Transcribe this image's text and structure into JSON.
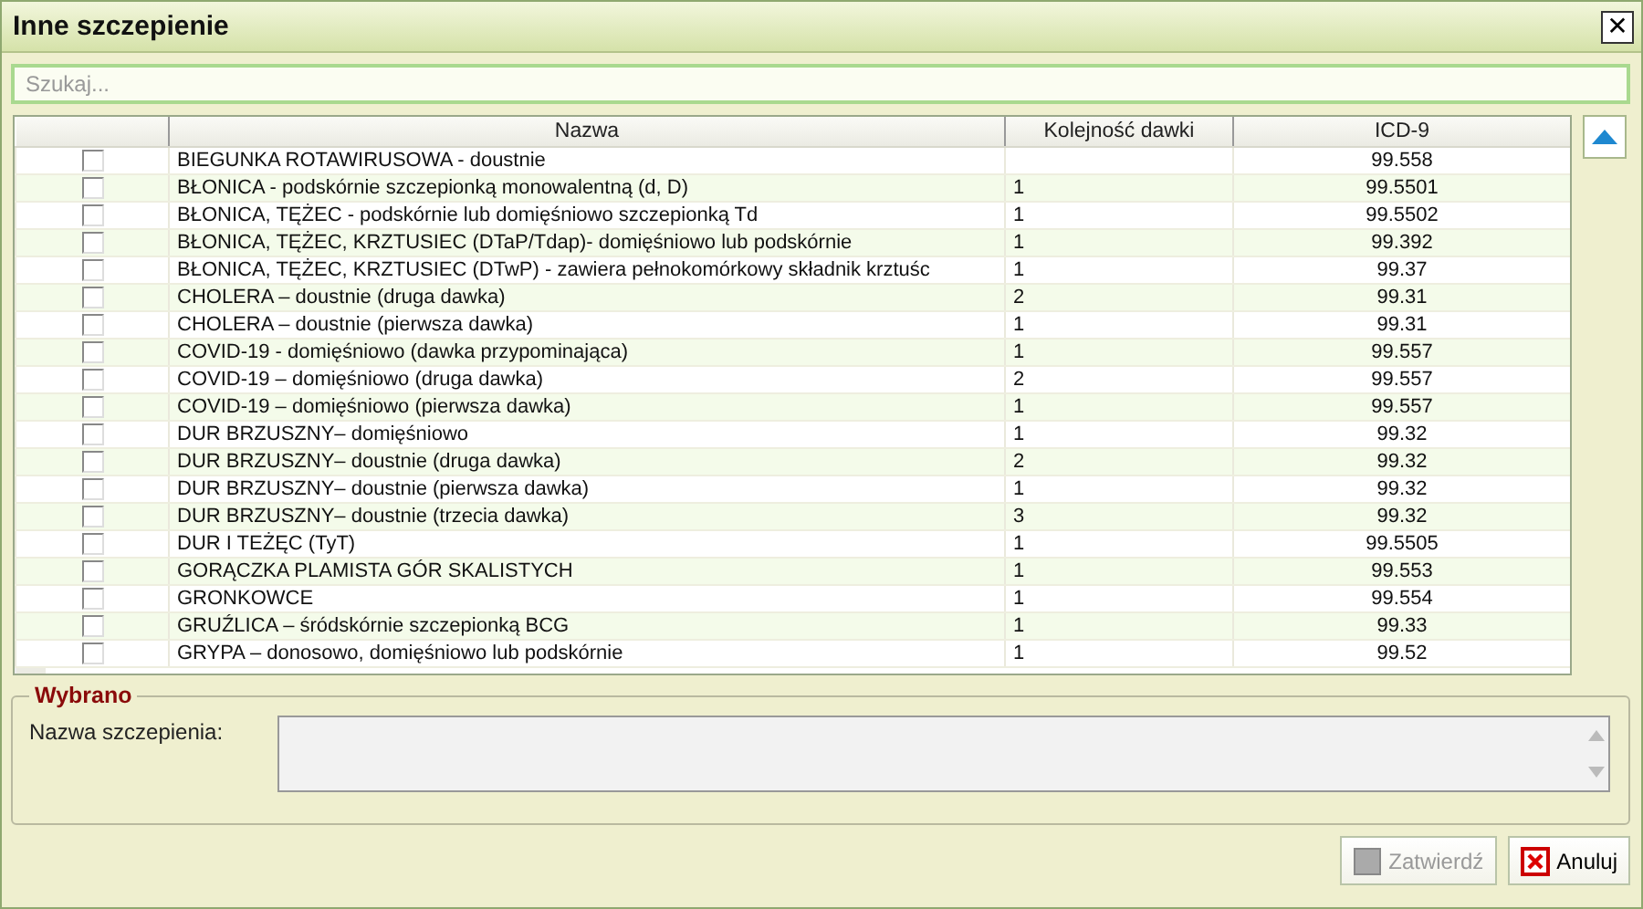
{
  "window": {
    "title": "Inne szczepienie",
    "close": "✕"
  },
  "search": {
    "placeholder": "Szukaj..."
  },
  "table": {
    "columns": [
      "Nazwa",
      "Kolejność dawki",
      "ICD-9"
    ],
    "rows": [
      {
        "checked": false,
        "name": "BIEGUNKA ROTAWIRUSOWA - doustnie",
        "icd": "99.558"
      },
      {
        "checked": false,
        "name": "BŁONICA - podskórnie szczepionką monowalentną (d, D)",
        "dose": "1",
        "icd": "99.5501"
      },
      {
        "checked": false,
        "name": "BŁONICA, TĘŻEC - podskórnie lub domięśniowo szczepionką Td",
        "dose": "1",
        "icd": "99.5502"
      },
      {
        "checked": false,
        "name": "BŁONICA, TĘŻEC, KRZTUSIEC (DTaP/Tdap)- domięśniowo lub podskórnie",
        "dose": "1",
        "icd": "99.392"
      },
      {
        "checked": false,
        "name": "BŁONICA, TĘŻEC, KRZTUSIEC (DTwP) - zawiera pełnokomórkowy składnik krztuśc",
        "dose": "1",
        "icd": "99.37"
      },
      {
        "checked": false,
        "name": "CHOLERA – doustnie (druga dawka)",
        "dose": "2",
        "icd": "99.31"
      },
      {
        "checked": false,
        "name": "CHOLERA – doustnie (pierwsza dawka)",
        "dose": "1",
        "icd": "99.31"
      },
      {
        "checked": false,
        "name": "COVID-19 - domięśniowo (dawka przypominająca)",
        "dose": "1",
        "icd": "99.557"
      },
      {
        "checked": false,
        "name": "COVID-19 – domięśniowo (druga dawka)",
        "dose": "2",
        "icd": "99.557"
      },
      {
        "checked": false,
        "name": "COVID-19 – domięśniowo (pierwsza dawka)",
        "dose": "1",
        "icd": "99.557"
      },
      {
        "checked": false,
        "name": "DUR BRZUSZNY– domięśniowo",
        "dose": "1",
        "icd": "99.32"
      },
      {
        "checked": false,
        "name": "DUR BRZUSZNY– doustnie (druga dawka)",
        "dose": "2",
        "icd": "99.32"
      },
      {
        "checked": false,
        "name": "DUR BRZUSZNY– doustnie (pierwsza dawka)",
        "dose": "1",
        "icd": "99.32"
      },
      {
        "checked": false,
        "name": "DUR BRZUSZNY– doustnie (trzecia dawka)",
        "dose": "3",
        "icd": "99.32"
      },
      {
        "checked": false,
        "name": "DUR I TEŻĘC (TyT)",
        "dose": "1",
        "icd": "99.5505"
      },
      {
        "checked": false,
        "name": "GORĄCZKA PLAMISTA GÓR SKALISTYCH",
        "dose": "1",
        "icd": "99.553"
      },
      {
        "checked": false,
        "name": "GRONKOWCE",
        "dose": "1",
        "icd": "99.554"
      },
      {
        "checked": false,
        "name": "GRUŹLICA – śródskórnie szczepionką BCG",
        "dose": "1",
        "icd": "99.33"
      },
      {
        "checked": false,
        "name": "GRYPA – donosowo, domięśniowo lub podskórnie",
        "dose": "1",
        "icd": "99.52"
      }
    ]
  },
  "selected_group": {
    "title": "Wybrano",
    "label": "Nazwa szczepienia:"
  },
  "buttons": [
    {
      "label": "Zatwierdź",
      "kind": "confirm",
      "disabled": true
    },
    {
      "label": "Anuluj",
      "kind": "cancel",
      "disabled": false
    }
  ]
}
